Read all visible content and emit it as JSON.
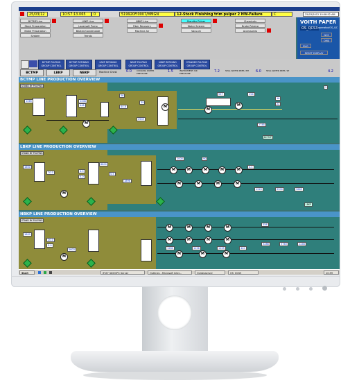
{
  "header": {
    "date": "25/03/12",
    "time": "10:57:13.065",
    "count": "0",
    "alarm_code": "519920FI0007/MMGN",
    "alarm_text": "12-Stock Finishing trim pulper 2 HW-Failure",
    "alarm_class": "C",
    "status_line": "25/03/2012 10:58:52 AM",
    "user": "operator/OS_QC"
  },
  "menu": {
    "col1": [
      "BCTMP Line",
      "Stock Preparation",
      "Broke Preparation",
      "System"
    ],
    "col2": [
      "LBKP Line",
      "Lagersaft Pump",
      "Beaten/Condensate",
      "Trends"
    ],
    "col3": [
      "NBKP Line",
      "Fiber Recovery",
      "Machine Air"
    ],
    "col4": [
      "Standby Pulper",
      "Water System",
      "Vacuum"
    ],
    "col5": [
      "Chemicals",
      "Broke Pulping",
      "Accessories"
    ]
  },
  "brand": {
    "name": "VOITH PAPER",
    "station": "OS_QCS3",
    "buttons": [
      "NCS",
      "QMS",
      "BVG",
      "RESET DISPLAY"
    ]
  },
  "group_buttons": [
    "BCTMP PULPING GROUP CONTROL",
    "BCTMP REFINING GROUP CONTROL",
    "LBKP REFINING GROUP CONTROL",
    "NBKP PULPING GROUP CONTROL",
    "NBKP REFINING GROUP CONTROL",
    "STANDBY PULPING GROUP CONTROL"
  ],
  "line_tabs": [
    "BCTMP",
    "LBKP",
    "NBKP"
  ],
  "readouts": {
    "machine_chest_label": "Machine Chest",
    "cooling_water_label": "COOLING WATER PRESSURE",
    "cooling_water_value": "0.0",
    "instrument_air_label": "INSTRUMENT AIR PRESSURE",
    "instrument_air_value": "1.5",
    "seal_water_pm_label": "SEAL WATER PRES. PM",
    "seal_water_pm_value": "7.2",
    "seal_water_sp_label": "SEAL WATER PRES. SP",
    "seal_water_sp_value": "6.0",
    "right_value": "4.2",
    "unit": "bar"
  },
  "sections": [
    {
      "title": "BCTMP LINE PRODUCTION OVERVIEW",
      "standby": "STAND BY PULPING",
      "tag": "BCTMP",
      "values": [
        "1265",
        "1208",
        "448",
        "56",
        "44.8",
        "39",
        "2505",
        "557",
        "256",
        "16",
        "22",
        "3",
        "2785"
      ]
    },
    {
      "title": "LBKP LINE PRODUCTION OVERVIEW",
      "standby": "STAND BY PULPING",
      "tag": "LBKP",
      "values": [
        "1600",
        "70.0",
        "4.0",
        "5.0",
        "6800",
        "5.5",
        "1896",
        "1000",
        "90",
        "4.1",
        "1220",
        "3300",
        "3665"
      ]
    },
    {
      "title": "NBKP LINE PRODUCTION OVERVIEW",
      "standby": "STAND BY PULPING",
      "tag": "NBKP",
      "values": [
        "1800",
        "20.0",
        "5.0",
        "5603",
        "1260",
        "1106",
        "1105",
        "440",
        "356",
        "3286",
        "3763",
        "2246"
      ]
    }
  ],
  "taskbar": {
    "start": "Start",
    "tasks": [
      "IFIX7 SDOOPC Server",
      "Outlines - Microsoft Inter...",
      "Ocldesserver",
      "OS_QCS3"
    ],
    "clock": "10:59"
  },
  "colors": {
    "screen_bg": "#3b7472",
    "section_bg": "#2f7f7b",
    "section_title": "#4a94c8",
    "olive": "#8f8c3a",
    "alarm_yellow": "#ffff44",
    "brand_blue": "#1a56a8"
  }
}
